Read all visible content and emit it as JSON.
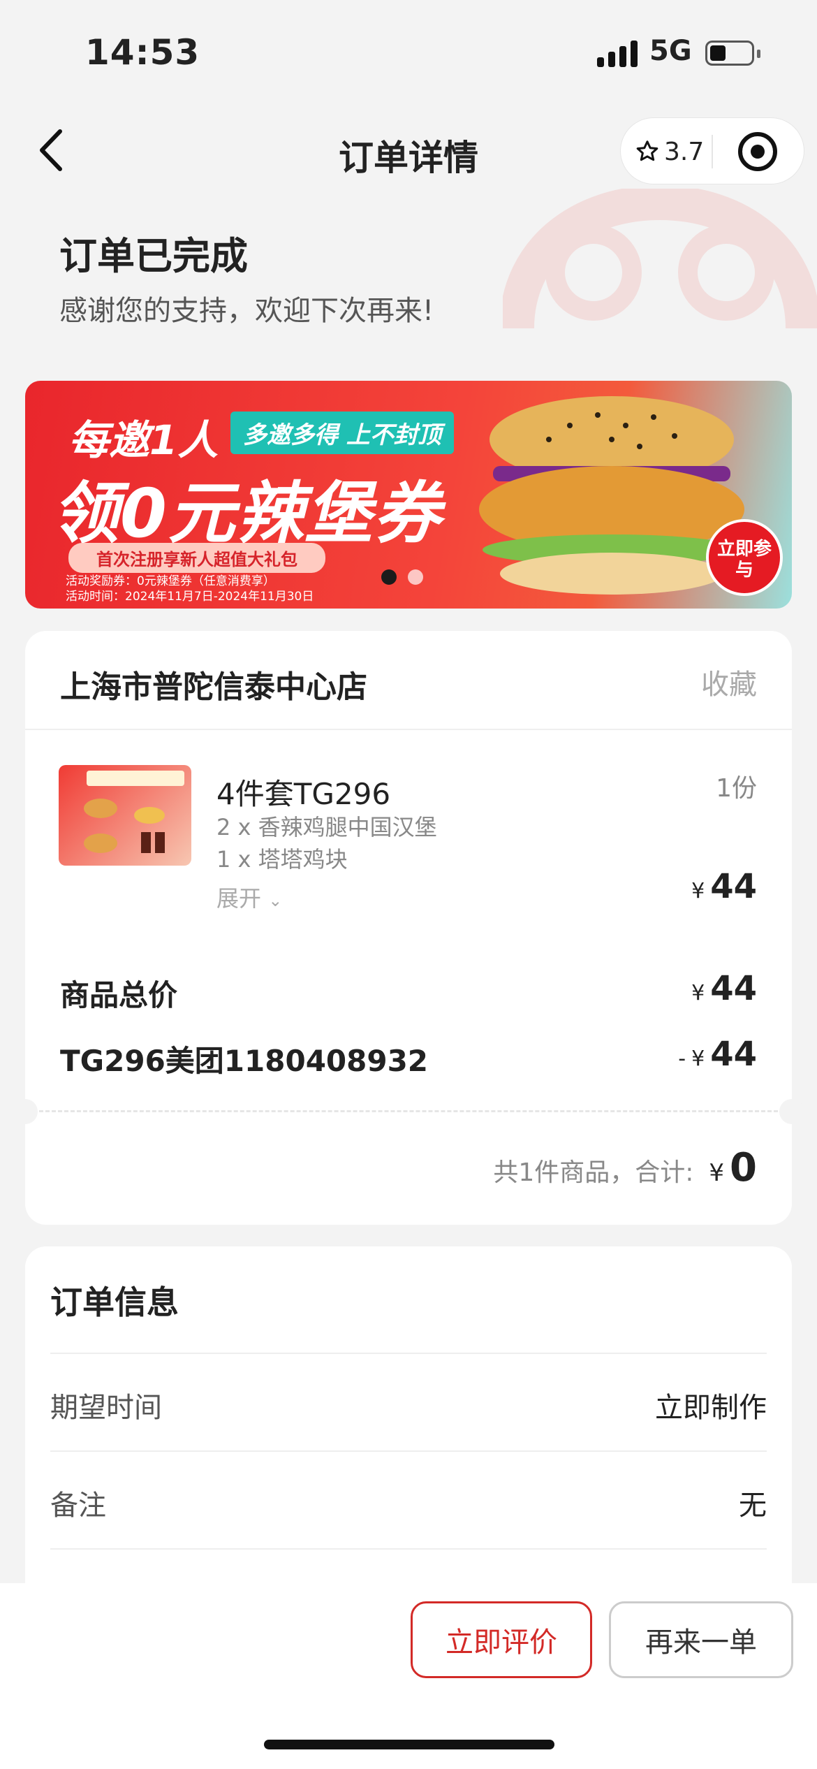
{
  "status_bar": {
    "time": "14:53",
    "network": "5G"
  },
  "nav": {
    "title": "订单详情",
    "rating": "3.7"
  },
  "order_status": {
    "title": "订单已完成",
    "subtitle": "感谢您的支持，欢迎下次再来!"
  },
  "banner": {
    "headline1": "每邀1人",
    "tag": "多邀多得 上不封顶",
    "headline2": "领0元辣堡券",
    "pill": "首次注册享新人超值大礼包",
    "line1": "活动奖励券：0元辣堡券（任意消费享）",
    "line2": "活动时间：2024年11月7日-2024年11月30日",
    "cta": "立即参与",
    "slide_count": 2,
    "active_slide": 1
  },
  "store": {
    "name": "上海市普陀信泰中心店",
    "favorite_label": "收藏"
  },
  "item": {
    "name": "4件套TG296",
    "quantity": "1份",
    "components": [
      "2 x 香辣鸡腿中国汉堡",
      "1 x 塔塔鸡块"
    ],
    "expand_label": "展开",
    "currency": "¥",
    "price": "44"
  },
  "summary": {
    "subtotal_label": "商品总价",
    "subtotal_currency": "¥",
    "subtotal": "44",
    "discount_label": "TG296美团1180408932",
    "discount_prefix": "-",
    "discount_currency": "¥",
    "discount": "44",
    "total_label": "共1件商品，合计:",
    "total_currency": "¥",
    "total": "0"
  },
  "order_info": {
    "title": "订单信息",
    "rows": [
      {
        "label": "期望时间",
        "value": "立即制作"
      },
      {
        "label": "备注",
        "value": "无"
      }
    ]
  },
  "actions": {
    "review": "立即评价",
    "reorder": "再来一单"
  },
  "colors": {
    "brand_red": "#d32a27",
    "page_bg": "#f3f3f3"
  }
}
